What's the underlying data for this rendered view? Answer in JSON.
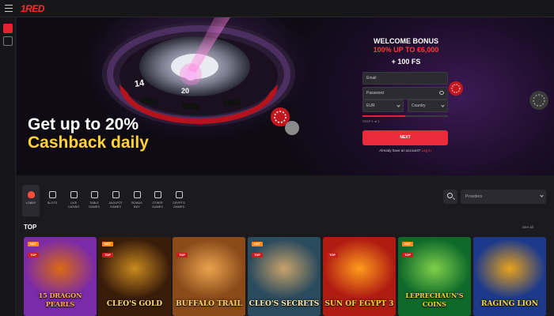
{
  "header": {
    "logo": "1RED"
  },
  "hero": {
    "headline_line1": "Get up to 20%",
    "headline_line2": "Cashback daily",
    "wheel_numbers": [
      "14",
      "20"
    ]
  },
  "signup": {
    "title": "WELCOME BONUS",
    "amount": "100% UP TO €6,000",
    "fs": "+ 100 FS",
    "email_placeholder": "Email",
    "password_placeholder": "Password",
    "currency": "EUR",
    "country_placeholder": "Country",
    "step": "STEP 1 of 2",
    "step_progress": 0.5,
    "next_label": "NEXT",
    "already_text": "Already have an account?",
    "login_label": "Log in"
  },
  "categories": [
    {
      "label": "LOBBY",
      "active": true
    },
    {
      "label": "SLOTS",
      "active": false
    },
    {
      "label": "LIVE CASINO",
      "active": false
    },
    {
      "label": "TABLE GAMES",
      "active": false
    },
    {
      "label": "JACKPOT GAMES",
      "active": false
    },
    {
      "label": "BONUS BUY",
      "active": false
    },
    {
      "label": "OTHER GAMES",
      "active": false
    },
    {
      "label": "CRYPTO GAMES",
      "active": false
    }
  ],
  "filter": {
    "provider_placeholder": "Providers"
  },
  "section": {
    "title": "TOP",
    "see_all": "See all"
  },
  "games": [
    {
      "name": "15 DRAGON PEARLS",
      "hot": true,
      "top": true,
      "bg1": "#7b2aa8",
      "bg2": "#d96b12",
      "text": "#ffb347"
    },
    {
      "name": "CLEO'S GOLD",
      "hot": true,
      "top": true,
      "bg1": "#3a1c0a",
      "bg2": "#c88a1e",
      "text": "#ffe27a"
    },
    {
      "name": "BUFFALO TRAIL",
      "hot": false,
      "top": true,
      "bg1": "#8a4a1a",
      "bg2": "#e9a34d",
      "text": "#ffd36b"
    },
    {
      "name": "CLEO'S SECRETS",
      "hot": true,
      "top": true,
      "bg1": "#2b4b5e",
      "bg2": "#c8a26a",
      "text": "#ffe9a8"
    },
    {
      "name": "SUN OF EGYPT 3",
      "hot": false,
      "top": true,
      "bg1": "#b01c12",
      "bg2": "#ff9b1c",
      "text": "#ffd23a"
    },
    {
      "name": "LEPRECHAUN'S COINS",
      "hot": true,
      "top": true,
      "bg1": "#0f6a2a",
      "bg2": "#7ed04a",
      "text": "#ffd23a"
    },
    {
      "name": "RAGING LION",
      "hot": false,
      "top": false,
      "bg1": "#1d3a8a",
      "bg2": "#e8a21a",
      "text": "#ffd23a"
    }
  ],
  "colors": {
    "accent": "#ea2b3a",
    "highlight": "#ffd23a",
    "background": "#1b1b1f"
  }
}
